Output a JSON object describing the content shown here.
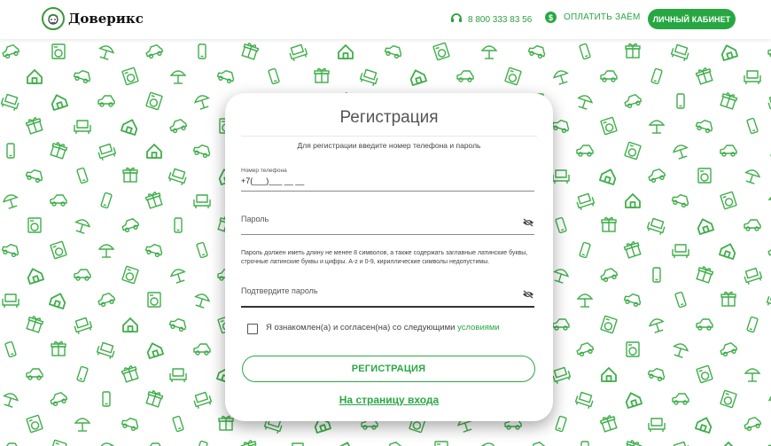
{
  "header": {
    "logo_text": "Доверикс",
    "phone": "8 800 333 83 56",
    "pay_label": "ОПЛАТИТЬ ЗАЁМ",
    "pay_icon": "$",
    "cabinet_label": "ЛИЧНЫЙ КАБИНЕТ"
  },
  "form": {
    "title": "Регистрация",
    "subtitle": "Для регистрации введите номер телефона и пароль",
    "phone_label": "Номер телефона",
    "phone_value": "+7(___)___ __ __",
    "password_label": "Пароль",
    "password_hint": "Пароль должен иметь длину не менее 8 символов, а также содержать заглавные латинские буквы, строчные латинские буквы и цифры. A-z и 0-9, кириллические символы недопустимы.",
    "confirm_label": "Подтвердите пароль",
    "agree_text": "Я ознакомлен(а) и согласен(на) со следующими ",
    "agree_link": "условиями",
    "register_button": "РЕГИСТРАЦИЯ",
    "login_link": "На страницу входа"
  },
  "colors": {
    "accent": "#27a742",
    "pattern": "#3fae4a"
  },
  "icons": {
    "phone": "phone-headset-icon",
    "pay": "dollar-circle-icon",
    "eye": "eye-off-icon",
    "pattern": [
      "car-icon",
      "gift-icon",
      "umbrella-icon",
      "house-icon",
      "phone-icon",
      "washing-machine-icon",
      "armchair-icon",
      "mobile-phone-icon"
    ]
  }
}
